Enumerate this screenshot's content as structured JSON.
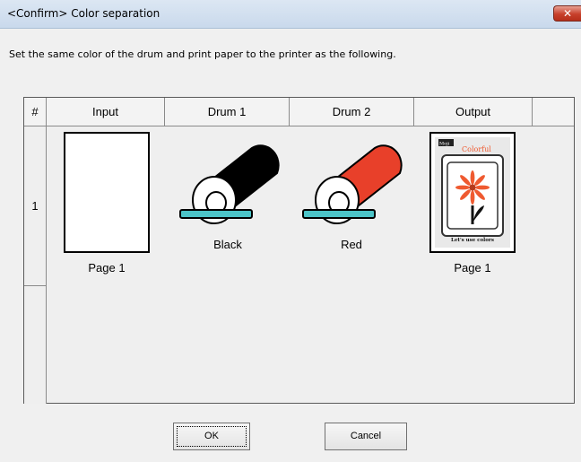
{
  "window": {
    "title": "<Confirm> Color separation",
    "close_glyph": "✕"
  },
  "instruction": "Set the same color of the drum and print paper to the printer as the following.",
  "table": {
    "headers": [
      "#",
      "Input",
      "Drum 1",
      "Drum 2",
      "Output",
      ""
    ],
    "rows": [
      {
        "number": "1",
        "input_label": "Page 1",
        "drum1_label": "Black",
        "drum1_color": "#000000",
        "drum2_label": "Red",
        "drum2_color": "#e8402a",
        "output_label": "Page 1",
        "output_thumb": {
          "tag": "Moji",
          "headline": "Colorful",
          "caption": "Let's use colors",
          "flower_color": "#ef5a30"
        }
      }
    ]
  },
  "buttons": {
    "ok": "OK",
    "cancel": "Cancel"
  }
}
